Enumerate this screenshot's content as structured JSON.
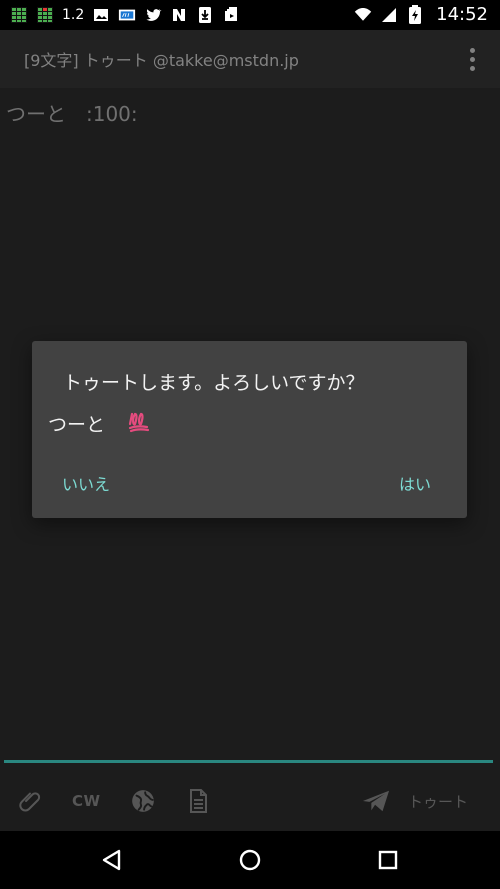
{
  "status_bar": {
    "speed": "1.2",
    "time": "14:52",
    "icons": [
      "signal-bars-icon",
      "signal-bars-icon-2",
      "image-icon",
      "hundred-icon",
      "twitter-icon",
      "notification-icon",
      "download-icon",
      "image-stack-icon",
      "wifi-icon",
      "cellular-icon",
      "battery-icon"
    ]
  },
  "header": {
    "title": "[9文字] トゥート @takke@mstdn.jp",
    "menu_icon": "more-vert-icon"
  },
  "editor": {
    "text": "つーと　:100:"
  },
  "dialog": {
    "title": "トゥートします。よろしいですか？",
    "message": "つーと",
    "emoji_label": "hundred-points-emoji",
    "negative_label": "いいえ",
    "positive_label": "はい"
  },
  "toolbar": {
    "attach_icon": "paperclip-icon",
    "cw_label": "CW",
    "visibility_icon": "globe-icon",
    "draft_icon": "document-icon",
    "send_icon": "send-icon",
    "submit_label": "トゥート"
  },
  "navigation": {
    "back_icon": "back-icon",
    "home_icon": "home-icon",
    "recents_icon": "recents-icon"
  },
  "colors": {
    "accent": "#7ddbd3",
    "underline": "#2d8f87",
    "dialog_background": "#424242",
    "app_background": "#1e1e1e",
    "header_background": "#242424",
    "emoji": "#e54b7e"
  }
}
